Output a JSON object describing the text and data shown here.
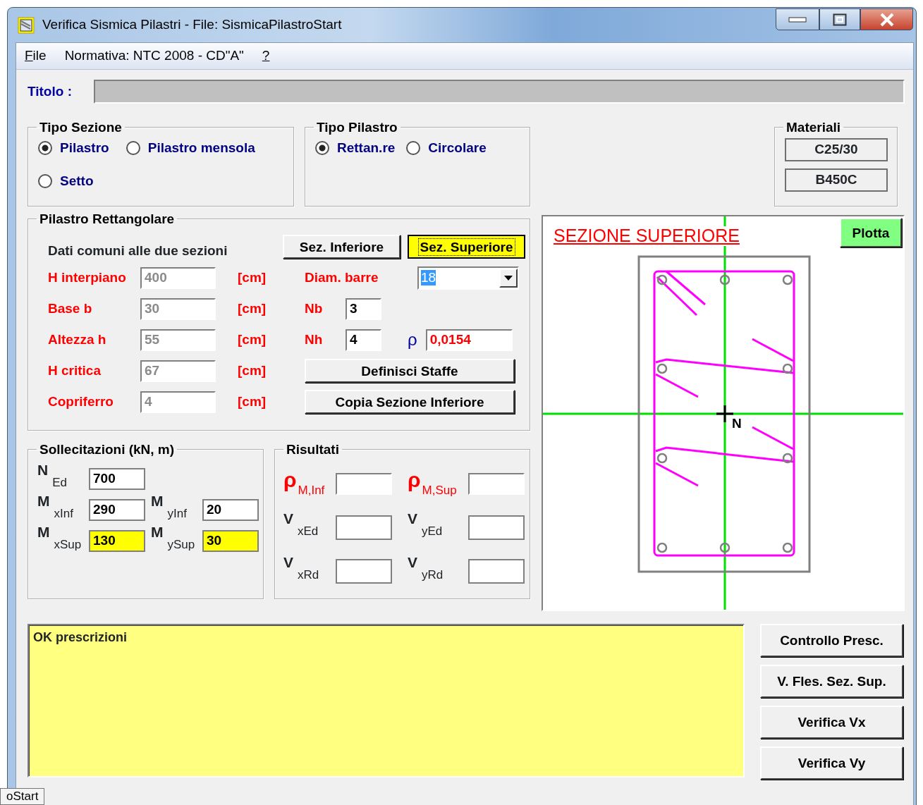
{
  "window": {
    "title": "Verifica Sismica Pilastri - File: SismicaPilastroStart"
  },
  "menu": [
    {
      "label": "File",
      "access_key": true
    },
    {
      "label": "Normativa: NTC 2008 - CD\"A\"",
      "access_key": false
    },
    {
      "label": "?",
      "access_key": true
    }
  ],
  "titolo": {
    "label": "Titolo :"
  },
  "tipo_sezione": {
    "title": "Tipo Sezione",
    "options": [
      {
        "label": "Pilastro",
        "selected": true
      },
      {
        "label": "Pilastro mensola",
        "selected": false
      },
      {
        "label": "Setto",
        "selected": false
      }
    ]
  },
  "tipo_pilastro": {
    "title": "Tipo Pilastro",
    "options": [
      {
        "label": "Rettan.re",
        "selected": true
      },
      {
        "label": "Circolare",
        "selected": false
      }
    ]
  },
  "materiali": {
    "title": "Materiali",
    "items": [
      "C25/30",
      "B450C"
    ]
  },
  "pilastro_rettangolare": {
    "title": "Pilastro Rettangolare",
    "subtitle": "Dati comuni alle due sezioni",
    "section_buttons": [
      {
        "label": "Sez. Inferiore",
        "selected": false
      },
      {
        "label": "Sez. Superiore",
        "selected": true
      }
    ],
    "fields": [
      {
        "label": "H interpiano",
        "value": "400",
        "unit": "[cm]",
        "disabled": true
      },
      {
        "label": "Base b",
        "value": "30",
        "unit": "[cm]",
        "disabled": true
      },
      {
        "label": "Altezza h",
        "value": "55",
        "unit": "[cm]",
        "disabled": true
      },
      {
        "label": "H critica",
        "value": "67",
        "unit": "[cm]",
        "disabled": true
      },
      {
        "label": "Copriferro",
        "value": "4",
        "unit": "[cm]",
        "disabled": true
      }
    ],
    "diam_barre": {
      "label": "Diam. barre",
      "value": "18"
    },
    "nb": {
      "label": "Nb",
      "value": "3"
    },
    "nh": {
      "label": "Nh",
      "value": "4"
    },
    "rho": {
      "label": "ρ",
      "value": "0,0154"
    },
    "buttons": [
      "Definisci Staffe",
      "Copia Sezione Inferiore"
    ]
  },
  "sollecitazioni": {
    "title": "Sollecitazioni (kN, m)",
    "rows": [
      [
        {
          "label": "N$_{Ed}$",
          "value": "700",
          "highlighted": false
        }
      ],
      [
        {
          "label": "M$_{xInf}$",
          "value": "290",
          "highlighted": false
        },
        {
          "label": "M$_{yInf}$",
          "value": "20",
          "highlighted": false
        }
      ],
      [
        {
          "label": "M$_{xSup}$",
          "value": "130",
          "highlighted": true
        },
        {
          "label": "M$_{ySup}$",
          "value": "30",
          "highlighted": true
        }
      ]
    ]
  },
  "risultati": {
    "title": "Risultati",
    "rows": [
      [
        {
          "label": "ρ$_{M,Inf}$",
          "kind": "ratio"
        },
        {
          "label": "ρ$_{M,Sup}$",
          "kind": "ratio"
        }
      ],
      [
        {
          "label": "V$_{xEd}$",
          "kind": "shear"
        },
        {
          "label": "V$_{yEd}$",
          "kind": "shear"
        }
      ],
      [
        {
          "label": "V$_{xRd}$",
          "kind": "shear"
        },
        {
          "label": "V$_{yRd}$",
          "kind": "shear"
        }
      ]
    ]
  },
  "drawing": {
    "title": "SEZIONE SUPERIORE",
    "button": "Plotta",
    "centroid_label": "N"
  },
  "messages": {
    "text": "OK prescrizioni"
  },
  "actions": [
    "Controllo Presc.",
    "V. Fles. Sez. Sup.",
    "Verifica Vx",
    "Verifica Vy"
  ],
  "taskbar_tooltip": "oStart"
}
